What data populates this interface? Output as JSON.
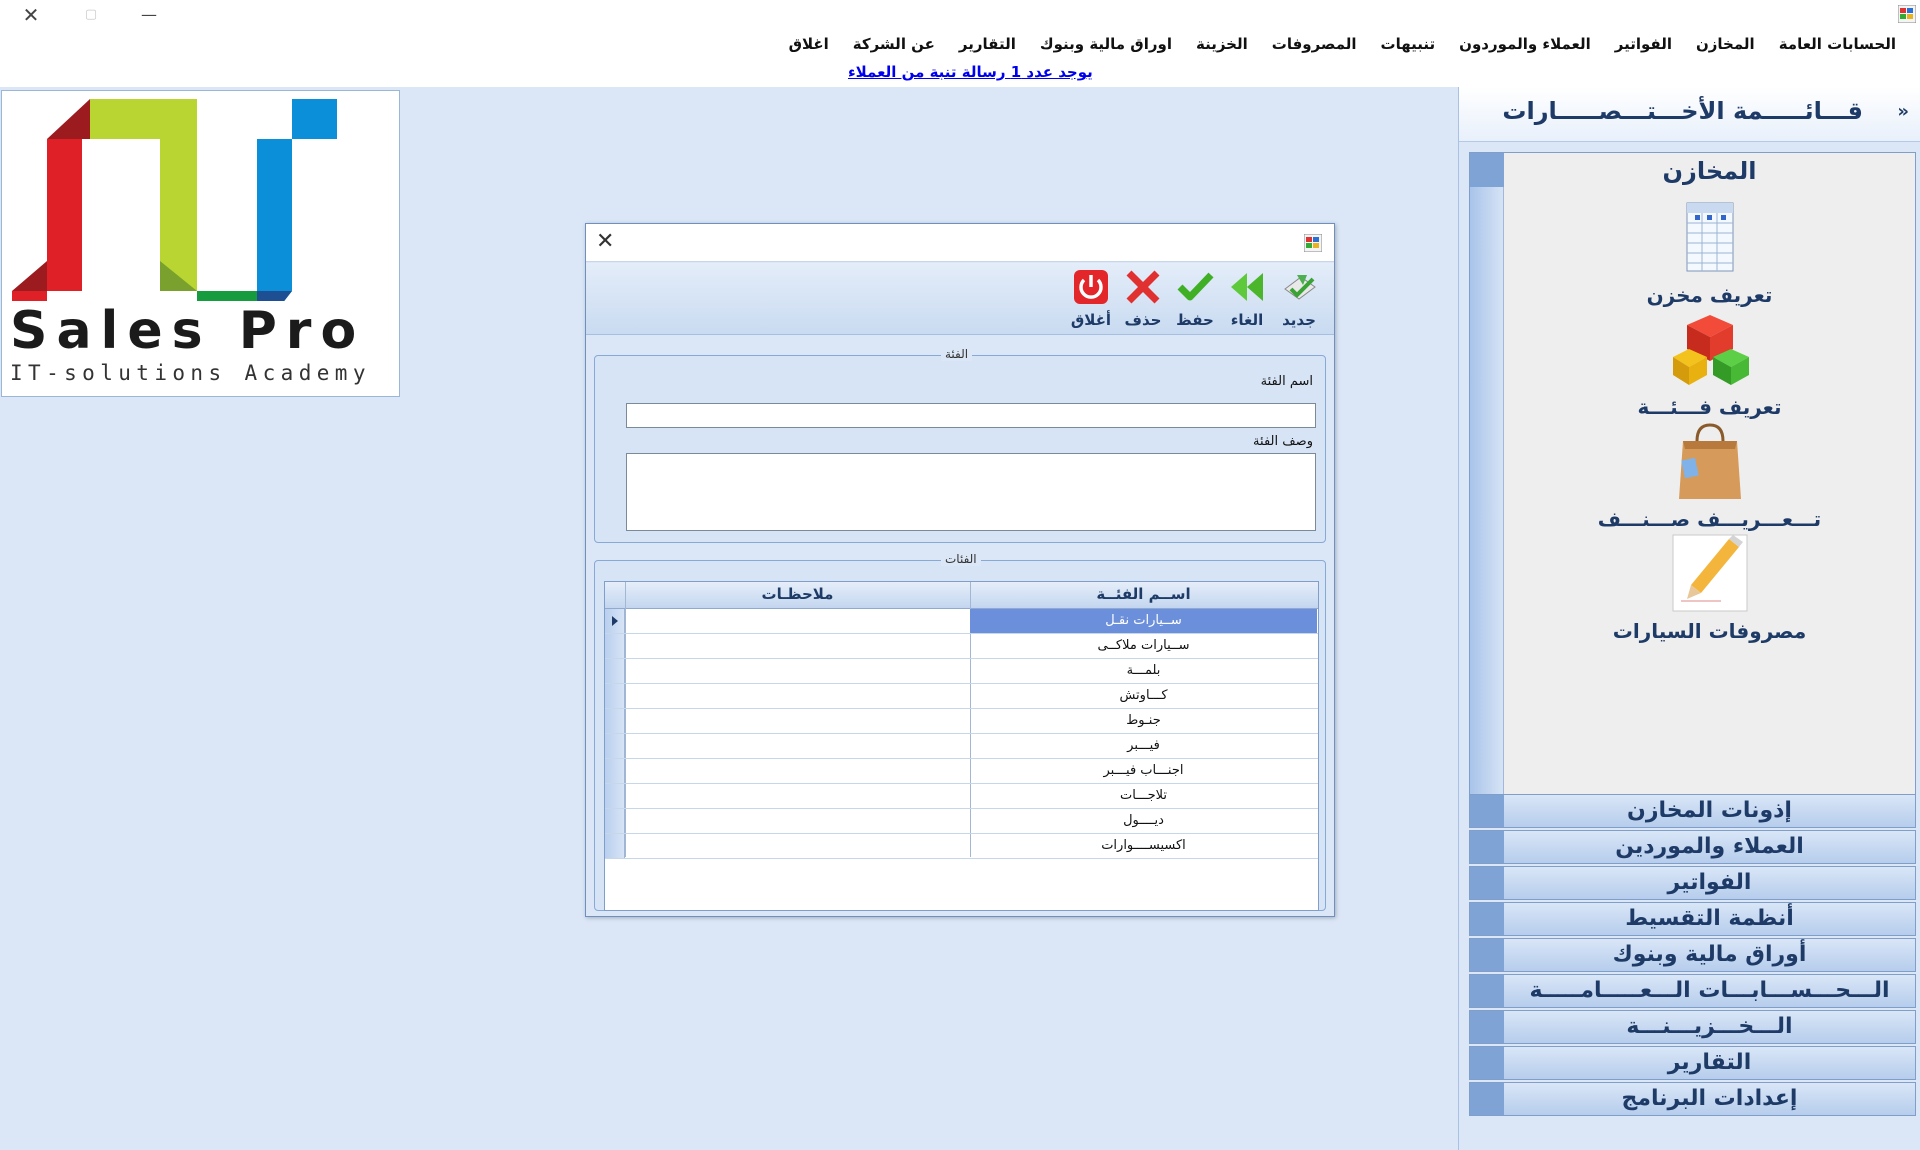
{
  "menu": {
    "items": [
      "الحسابات العامة",
      "المخازن",
      "الفواتير",
      "العملاء والموردون",
      "تنبيهات",
      "المصروفات",
      "الخزينة",
      "اوراق مالية وبنوك",
      "التقارير",
      "عن الشركة",
      "اغلاق"
    ]
  },
  "notice": {
    "text": "يوجد عدد  1 رسالة تنبة من العملاء "
  },
  "logo": {
    "name": "Sales Pro",
    "tagline": "IT-solutions Academy"
  },
  "sidebar": {
    "title": "قـــائـــــمة الأخـــتـــصـــــارات",
    "collapse": "»",
    "open_group": {
      "title": "المخازن",
      "shortcuts": [
        {
          "label": "تعريف مخزن",
          "icon": "spreadsheet-icon"
        },
        {
          "label": "تعريف فـــئـــة",
          "icon": "cubes-icon"
        },
        {
          "label": "تـــعـــريـــف صـــنـــف",
          "icon": "shopping-bag-icon"
        },
        {
          "label": "مصروفات السيارات",
          "icon": "pencil-note-icon"
        }
      ]
    },
    "groups": [
      "إذونات المخازن",
      "العملاء والموردين",
      "الفواتير",
      "أنظمة التقسيط",
      "أوراق مالية وبنوك",
      "الـــحـــســـابـــات الـــعـــــامـــــة",
      "الـــخـــزيـــنـــة",
      "التقارير",
      "إعدادات البرنامج"
    ]
  },
  "dialog": {
    "close": "✕",
    "toolbar": {
      "new": "جديد",
      "cancel": "الغاء",
      "save": "حفظ",
      "delete": "حذف",
      "close": "أغلاق"
    },
    "category_fieldset": {
      "legend": "الفئة",
      "name_label": "اسم الفئة",
      "name_value": "",
      "desc_label": "وصف الفئة",
      "desc_value": ""
    },
    "categories_fieldset": {
      "legend": "الفئات",
      "columns": {
        "name": "اســم الفئــة",
        "notes": "ملاحظـات"
      },
      "rows": [
        {
          "name": "ســيارات نقـل",
          "notes": ""
        },
        {
          "name": "ســيارات ملاكــى",
          "notes": ""
        },
        {
          "name": "بلمـــة",
          "notes": ""
        },
        {
          "name": "كـــاوتش",
          "notes": ""
        },
        {
          "name": "جنـوط",
          "notes": ""
        },
        {
          "name": "فيـــبر",
          "notes": ""
        },
        {
          "name": "اجنـــاب فيـــبر",
          "notes": ""
        },
        {
          "name": "تلاجـــات",
          "notes": ""
        },
        {
          "name": "ديــــول",
          "notes": ""
        },
        {
          "name": "اكسيســــوارات",
          "notes": ""
        }
      ],
      "selected_index": 0
    }
  },
  "colors": {
    "accent": "#1e3b67",
    "selection": "#6c8fdc",
    "background": "#dbe7f7"
  }
}
